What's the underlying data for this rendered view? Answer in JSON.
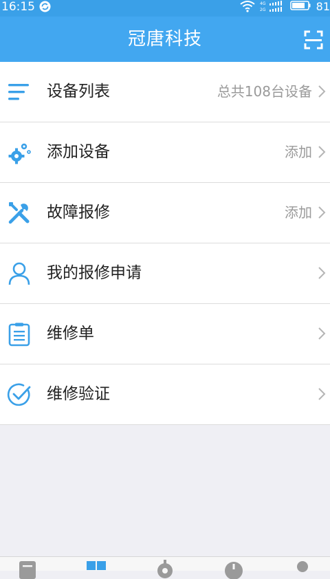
{
  "status_bar": {
    "time": "16:15",
    "battery": "81",
    "network_labels": [
      "4G",
      "2G"
    ]
  },
  "header": {
    "title": "冠唐科技"
  },
  "menu": {
    "items": [
      {
        "label": "设备列表",
        "value": "总共108台设备",
        "icon": "list-icon"
      },
      {
        "label": "添加设备",
        "value": "添加",
        "icon": "gears-icon"
      },
      {
        "label": "故障报修",
        "value": "添加",
        "icon": "tools-icon"
      },
      {
        "label": "我的报修申请",
        "value": "",
        "icon": "user-icon"
      },
      {
        "label": "维修单",
        "value": "",
        "icon": "clipboard-icon"
      },
      {
        "label": "维修验证",
        "value": "",
        "icon": "check-circle-icon"
      }
    ]
  },
  "bottom_tabs": [
    "doc-icon",
    "grid-icon",
    "gear-icon",
    "info-icon",
    "person-icon"
  ],
  "colors": {
    "primary": "#42a7f0",
    "status_bar": "#3aa0e8",
    "background": "#efeff4",
    "icon": "#3aa0e8"
  }
}
